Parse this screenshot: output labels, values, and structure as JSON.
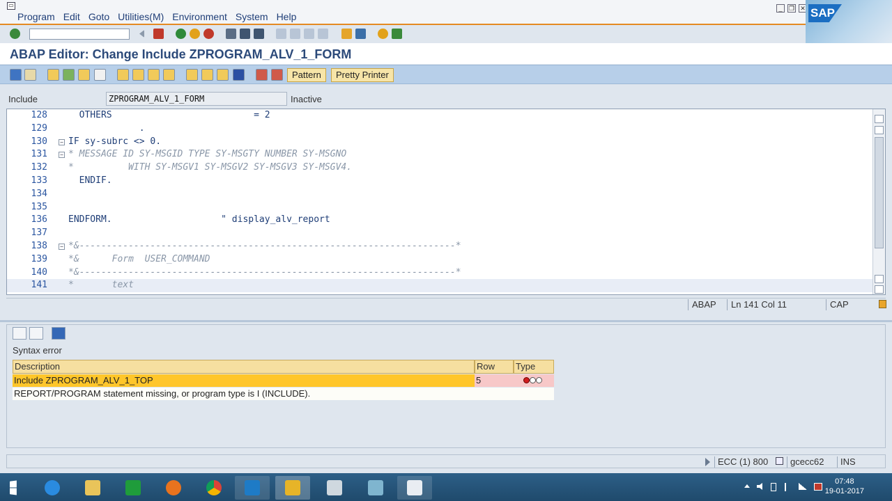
{
  "menubar": {
    "items": [
      "Program",
      "Edit",
      "Goto",
      "Utilities(M)",
      "Environment",
      "System",
      "Help"
    ]
  },
  "logo": {
    "text": "SAP"
  },
  "title": "ABAP Editor: Change Include ZPROGRAM_ALV_1_FORM",
  "toolbar2": {
    "pattern_label": "Pattern",
    "pretty_printer_label": "Pretty Printer"
  },
  "include": {
    "label": "Include",
    "value": "ZPROGRAM_ALV_1_FORM",
    "status": "Inactive"
  },
  "editor": {
    "lines": [
      {
        "num": "128",
        "fold": "",
        "code": "  OTHERS                          = 2"
      },
      {
        "num": "129",
        "fold": "",
        "code": "             ."
      },
      {
        "num": "130",
        "fold": "⊟",
        "code": "IF sy-subrc <> 0."
      },
      {
        "num": "131",
        "fold": "⊟",
        "code": "* MESSAGE ID SY-MSGID TYPE SY-MSGTY NUMBER SY-MSGNO"
      },
      {
        "num": "132",
        "fold": "",
        "code": "*          WITH SY-MSGV1 SY-MSGV2 SY-MSGV3 SY-MSGV4."
      },
      {
        "num": "133",
        "fold": "",
        "code": "  ENDIF."
      },
      {
        "num": "134",
        "fold": "",
        "code": ""
      },
      {
        "num": "135",
        "fold": "",
        "code": ""
      },
      {
        "num": "136",
        "fold": "",
        "code": "ENDFORM.                    \" display_alv_report"
      },
      {
        "num": "137",
        "fold": "",
        "code": ""
      },
      {
        "num": "138",
        "fold": "⊟",
        "code": "*&---------------------------------------------------------------------*"
      },
      {
        "num": "139",
        "fold": "",
        "code": "*&      Form  USER_COMMAND"
      },
      {
        "num": "140",
        "fold": "",
        "code": "*&---------------------------------------------------------------------*"
      },
      {
        "num": "141",
        "fold": "",
        "code": "*       text"
      }
    ]
  },
  "editor_status": {
    "lang": "ABAP",
    "position": "Ln 141 Col 11",
    "caps": "CAP"
  },
  "error_pane": {
    "title": "Syntax error",
    "columns": [
      "Description",
      "Row",
      "Type"
    ],
    "row1": {
      "description": "Include ZPROGRAM_ALV_1_TOP",
      "row": "5",
      "type": "error-traffic-light"
    },
    "row2": {
      "description": "REPORT/PROGRAM statement missing, or program type is I (INCLUDE)."
    }
  },
  "statusbar": {
    "system": "ECC (1) 800",
    "server": "gcecc62",
    "mode": "INS"
  },
  "taskbar": {
    "time": "07:48",
    "date": "19-01-2017"
  },
  "colors": {
    "accent_orange": "#e58a22",
    "toolbar_blue": "#b7cfe9",
    "title_blue": "#2c4a7a",
    "header_yellow": "#f6dfa0",
    "selected_row": "#ffc62a",
    "error_pink": "#f7c8c8"
  }
}
